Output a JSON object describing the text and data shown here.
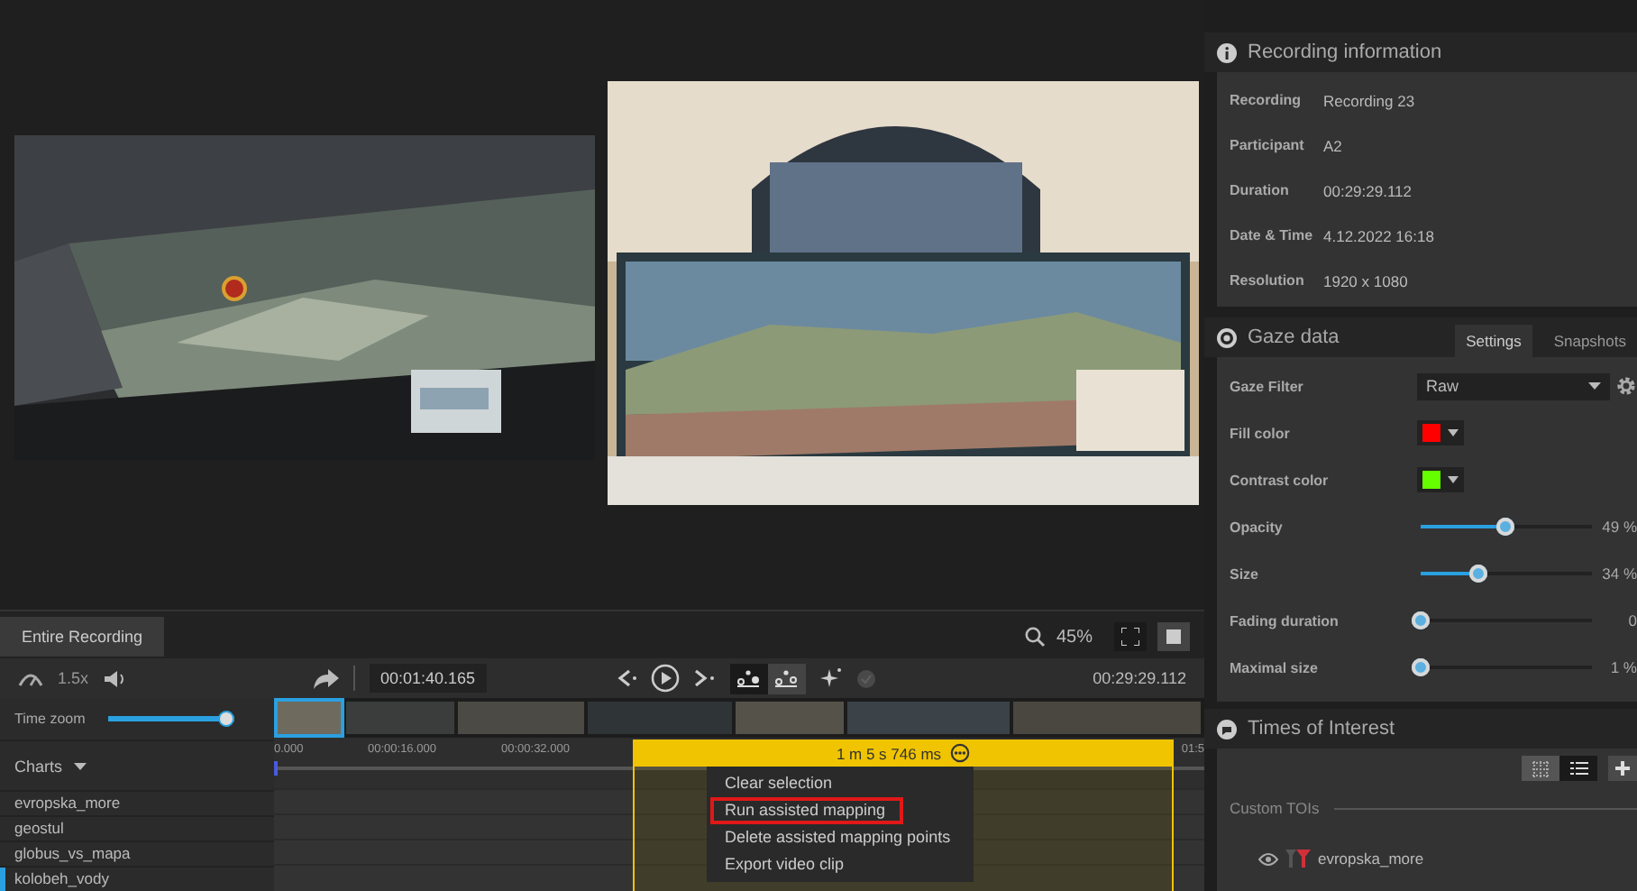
{
  "timeline": {
    "tabs": [
      {
        "label": "Entire Recording",
        "selected": true
      }
    ],
    "speed": "1.5x",
    "current_time": "00:01:40.165",
    "end_time": "00:29:29.112",
    "zoom": "45%",
    "modes": [
      {
        "kind": "points",
        "selected": true
      },
      {
        "kind": "points-alt",
        "selected": false
      }
    ],
    "time_zoom": {
      "label": "Time zoom",
      "level": 0.93
    },
    "charts_label": "Charts",
    "ticks": [
      "0.000",
      "00:00:16.000",
      "00:00:32.000",
      "01:5"
    ],
    "selection": {
      "duration": "1 m 5 s 746 ms"
    },
    "context_menu": [
      {
        "label": "Clear selection",
        "highlighted": false
      },
      {
        "label": "Run assisted mapping",
        "highlighted": true
      },
      {
        "label": "Delete assisted mapping points",
        "highlighted": false
      },
      {
        "label": "Export video clip",
        "highlighted": false
      }
    ],
    "rows": [
      {
        "name": "evropska_more",
        "selected": false
      },
      {
        "name": "geostul",
        "selected": false
      },
      {
        "name": "globus_vs_mapa",
        "selected": false
      },
      {
        "name": "kolobeh_vody",
        "selected": true
      }
    ]
  },
  "recording_info": {
    "title": "Recording information",
    "fields": [
      {
        "label": "Recording",
        "value": "Recording 23"
      },
      {
        "label": "Participant",
        "value": "A2"
      },
      {
        "label": "Duration",
        "value": "00:29:29.112"
      },
      {
        "label": "Date & Time",
        "value": "4.12.2022 16:18"
      },
      {
        "label": "Resolution",
        "value": "1920 x 1080"
      }
    ]
  },
  "gaze_data": {
    "title": "Gaze data",
    "tabs": [
      {
        "label": "Settings",
        "selected": true
      },
      {
        "label": "Snapshots",
        "selected": false
      }
    ],
    "settings": [
      {
        "kind": "select",
        "label": "Gaze Filter",
        "value": "Raw"
      },
      {
        "kind": "color",
        "label": "Fill color",
        "color": "#ff0000"
      },
      {
        "kind": "color",
        "label": "Contrast color",
        "color": "#66ff00"
      },
      {
        "kind": "slider",
        "label": "Opacity",
        "level": 0.49,
        "reading": "49 %"
      },
      {
        "kind": "slider",
        "label": "Size",
        "level": 0.34,
        "reading": "34 %"
      },
      {
        "kind": "slider",
        "label": "Fading duration",
        "level": 0,
        "reading": "0"
      },
      {
        "kind": "slider",
        "label": "Maximal size",
        "level": 0,
        "reading": "1 %"
      }
    ]
  },
  "times_of_interest": {
    "title": "Times of Interest",
    "views": [
      {
        "kind": "grid",
        "selected": false
      },
      {
        "kind": "list",
        "selected": true
      }
    ],
    "section": "Custom TOIs",
    "items": [
      {
        "name": "evropska_more",
        "color": "#d0303a"
      }
    ]
  }
}
